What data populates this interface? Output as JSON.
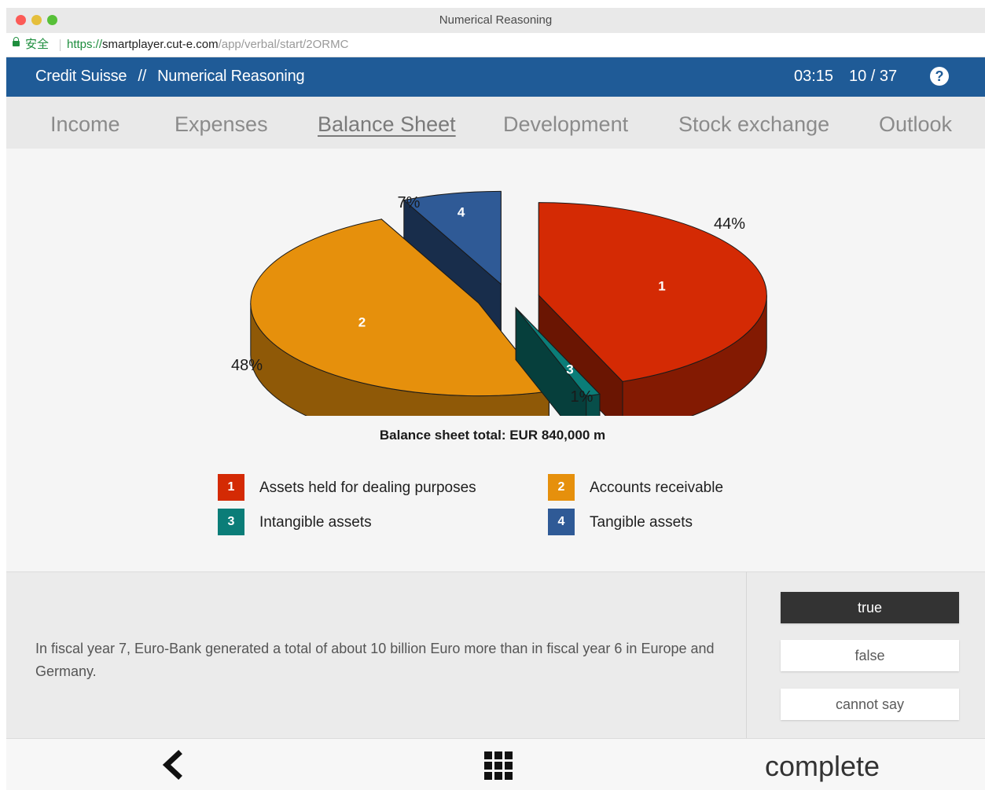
{
  "window": {
    "title": "Numerical Reasoning"
  },
  "urlbar": {
    "secure_label": "安全",
    "scheme": "https://",
    "host": "smartplayer.cut-e.com",
    "path": "/app/verbal/start/2ORMC"
  },
  "header": {
    "company": "Credit Suisse",
    "separator": "//",
    "test": "Numerical Reasoning",
    "timer": "03:15",
    "progress": "10 / 37"
  },
  "tabs": [
    {
      "label": "Income"
    },
    {
      "label": "Expenses"
    },
    {
      "label": "Balance Sheet"
    },
    {
      "label": "Development"
    },
    {
      "label": "Stock exchange"
    },
    {
      "label": "Outlook"
    }
  ],
  "chart_data": {
    "type": "pie",
    "title": "Balance sheet total: EUR 840,000 m",
    "slices": [
      {
        "id": "1",
        "label": "Assets held for dealing purposes",
        "value": 44,
        "value_label": "44%",
        "color": "#d42a04"
      },
      {
        "id": "2",
        "label": "Accounts receivable",
        "value": 48,
        "value_label": "48%",
        "color": "#e6900c"
      },
      {
        "id": "3",
        "label": "Intangible assets",
        "value": 1,
        "value_label": "1%",
        "color": "#0b7d78"
      },
      {
        "id": "4",
        "label": "Tangible assets",
        "value": 7,
        "value_label": "7%",
        "color": "#2f5a96"
      }
    ],
    "legend_position": "bottom"
  },
  "question": "In fiscal year 7, Euro-Bank generated a total of about 10 billion Euro more than in fiscal year 6 in Europe and Germany.",
  "answers": [
    {
      "label": "true",
      "selected": true
    },
    {
      "label": "false",
      "selected": false
    },
    {
      "label": "cannot say",
      "selected": false
    }
  ],
  "footer": {
    "back_icon": "chevron-left-icon",
    "menu_icon": "grid-icon",
    "complete_label": "complete"
  }
}
